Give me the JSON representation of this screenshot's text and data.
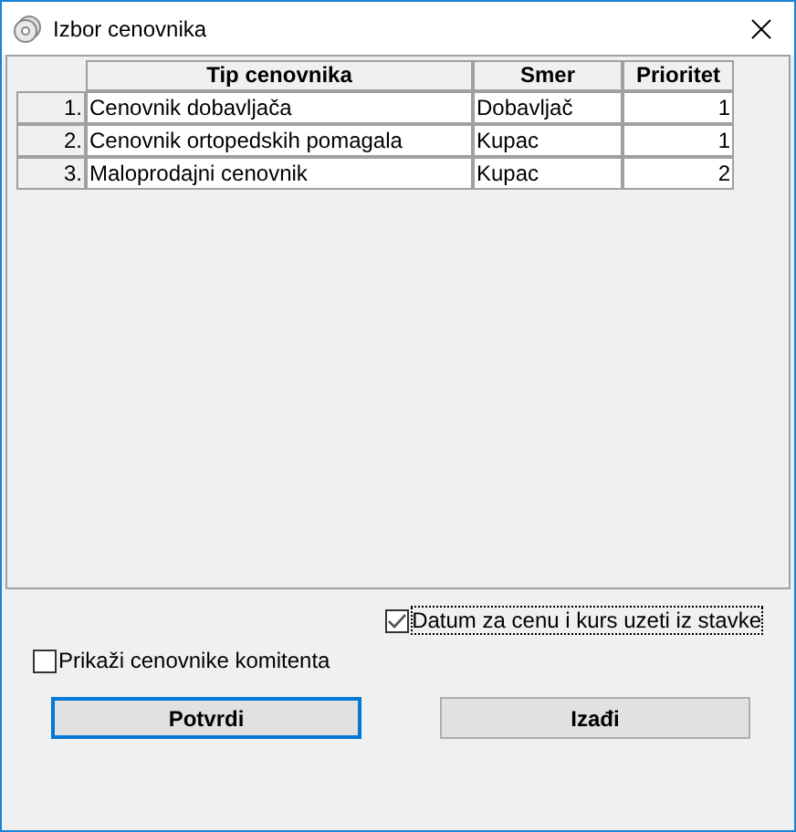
{
  "window": {
    "title": "Izbor cenovnika"
  },
  "table": {
    "columns": [
      "Tip cenovnika",
      "Smer",
      "Prioritet"
    ],
    "rows": [
      {
        "number": "1.",
        "cells": [
          "Cenovnik dobavljača",
          "Dobavljač",
          "1"
        ]
      },
      {
        "number": "2.",
        "cells": [
          "Cenovnik ortopedskih pomagala",
          "Kupac",
          "1"
        ]
      },
      {
        "number": "3.",
        "cells": [
          "Maloprodajni cenovnik",
          "Kupac",
          "2"
        ]
      }
    ]
  },
  "options": [
    {
      "label": "Datum za cenu i kurs uzeti iz stavke",
      "checked": true
    },
    {
      "label": "Prikaži cenovnike komitenta",
      "checked": false
    }
  ],
  "buttons": [
    {
      "label": "Potvrdi",
      "selected": true
    },
    {
      "label": "Izađi",
      "selected": false
    }
  ]
}
